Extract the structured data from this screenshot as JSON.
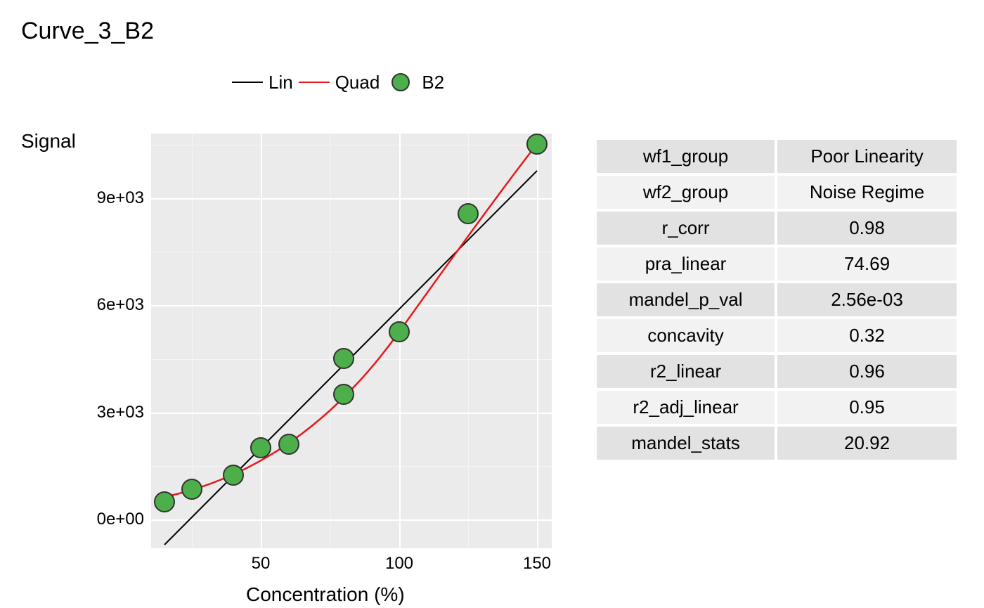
{
  "title": "Curve_3_B2",
  "legend": {
    "lin": "Lin",
    "quad": "Quad",
    "b2": "B2"
  },
  "ylabel": "Signal",
  "xlabel": "Concentration (%)",
  "ticks": {
    "x": [
      "50",
      "100",
      "150"
    ],
    "y": [
      "0e+00",
      "3e+03",
      "6e+03",
      "9e+03"
    ]
  },
  "table": [
    [
      "wf1_group",
      "Poor Linearity"
    ],
    [
      "wf2_group",
      "Noise Regime"
    ],
    [
      "r_corr",
      "0.98"
    ],
    [
      "pra_linear",
      "74.69"
    ],
    [
      "mandel_p_val",
      "2.56e-03"
    ],
    [
      "concavity",
      "0.32"
    ],
    [
      "r2_linear",
      "0.96"
    ],
    [
      "r2_adj_linear",
      "0.95"
    ],
    [
      "mandel_stats",
      "20.92"
    ]
  ],
  "chart_data": {
    "type": "scatter",
    "title": "Curve_3_B2",
    "xlabel": "Concentration (%)",
    "ylabel": "Signal",
    "xlim": [
      10,
      155
    ],
    "ylim": [
      -800,
      10800
    ],
    "series": [
      {
        "name": "B2",
        "type": "points",
        "color": "#4daf4a",
        "x": [
          15,
          25,
          40,
          50,
          60,
          80,
          80,
          100,
          125,
          150
        ],
        "y": [
          500,
          850,
          1250,
          2000,
          2100,
          3500,
          4500,
          5250,
          8550,
          10500
        ]
      },
      {
        "name": "Lin",
        "type": "line",
        "color": "#000000",
        "x": [
          15,
          150
        ],
        "y": [
          -700,
          9750
        ]
      },
      {
        "name": "Quad",
        "type": "line",
        "color": "#e41a1c",
        "x": [
          15,
          40,
          70,
          100,
          125,
          150
        ],
        "y": [
          630,
          1300,
          2850,
          5250,
          7700,
          10500
        ]
      }
    ]
  }
}
